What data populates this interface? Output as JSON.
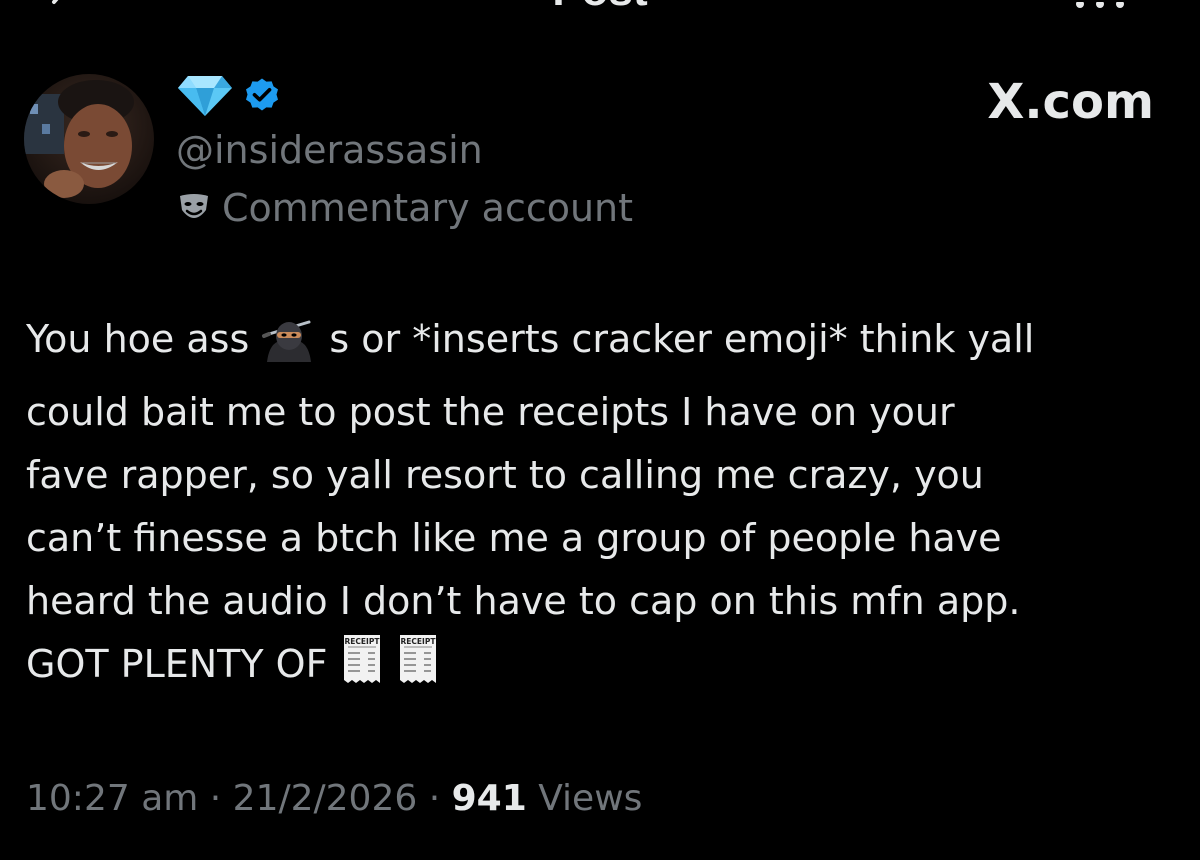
{
  "header": {
    "title": "Post",
    "back_icon": "back-arrow-icon",
    "more_icon": "more-dots-icon"
  },
  "author": {
    "display_name_emoji": "gem-stone-icon",
    "verified_icon": "verified-badge-icon",
    "handle": "@insiderassasin",
    "account_label": "Commentary account",
    "account_label_icon": "theater-masks-icon"
  },
  "watermark": "X.com",
  "tweet": {
    "line1_before": "You hoe ass ",
    "line1_emoji": "ninja-emoji",
    "line1_after": " s or *inserts cracker emoji* think yall",
    "line2": "could bait me to post the receipts I have on your",
    "line3": "fave rapper, so yall resort to calling me crazy, you",
    "line4": "can’t finesse a btch like me a group of people have",
    "line5": "heard the audio I don’t have to cap on this mfn app.",
    "line6": "GOT PLENTY OF ",
    "line6_emojis": [
      "receipt-emoji",
      "receipt-emoji"
    ],
    "receipt_emoji_text": "RECEIPT"
  },
  "meta": {
    "time": "10:27 am",
    "sep1": " · ",
    "date": "21/2/2026",
    "sep2": " · ",
    "views_count": "941",
    "views_label": " Views"
  },
  "colors": {
    "background": "#000000",
    "text": "#e7e9ea",
    "secondary": "#71767b",
    "verified": "#1d9bf0",
    "gem": "#5bc8f5"
  }
}
